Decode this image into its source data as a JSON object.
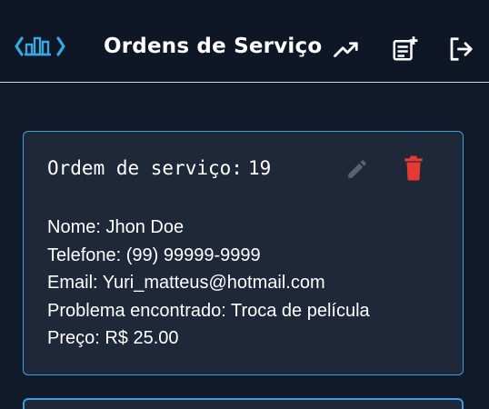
{
  "header": {
    "title": "Ordens de Serviço",
    "logo_icon": "chevron-building-logo",
    "actions": [
      {
        "icon": "trending-up-icon"
      },
      {
        "icon": "note-add-icon"
      },
      {
        "icon": "logout-icon"
      }
    ]
  },
  "order": {
    "title_label": "Ordem de serviço:",
    "number": "19",
    "name": "Nome: Jhon Doe",
    "phone": "Telefone: (99) 99999-9999",
    "email": "Email: Yuri_matteus@hotmail.com",
    "problem": "Problema encontrado: Troca de película",
    "price": "Preço: R$ 25.00"
  },
  "colors": {
    "background": "#101a2a",
    "header": "#0f1727",
    "card": "#1e2838",
    "card_border": "#3a9fdc",
    "logo": "#3aa8e0",
    "delete": "#e53935",
    "edit": "#5a6270"
  }
}
